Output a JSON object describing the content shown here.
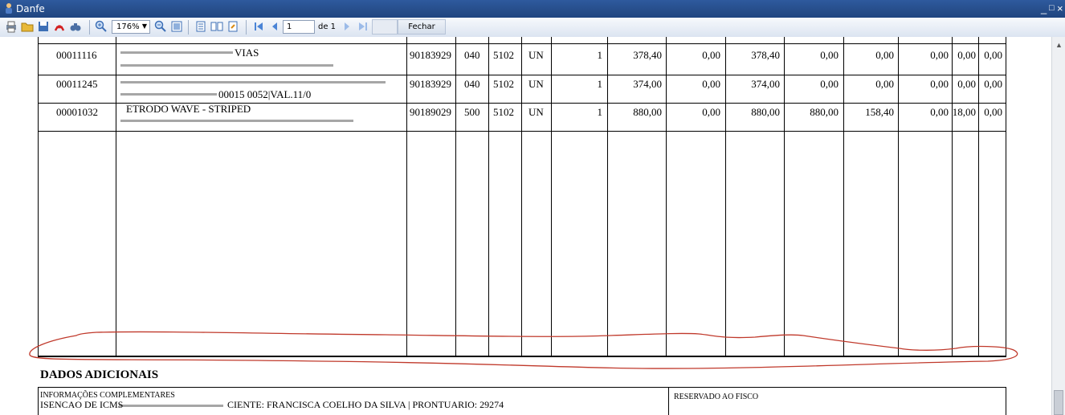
{
  "window": {
    "title": "Danfe",
    "minimize_glyph": "_",
    "restore_glyph": "□",
    "close_glyph": "×"
  },
  "toolbar": {
    "zoom_value": "176%",
    "page_current": "1",
    "page_total_label": "de 1",
    "close_label": "Fechar",
    "icons": [
      "print-icon",
      "open-icon",
      "save-icon",
      "pdf-icon",
      "find-icon",
      "zoom-in-icon",
      "zoom-out-icon",
      "fit-page-icon",
      "single-page-icon",
      "two-pages-icon",
      "page-setup-icon",
      "first-page-icon",
      "prev-page-icon",
      "next-page-icon",
      "last-page-icon"
    ]
  },
  "items": [
    {
      "code": "00011116",
      "desc_line1": "VIAS",
      "ncm": "90183929",
      "cst": "040",
      "cfop": "5102",
      "unit": "UN",
      "qty": "1",
      "unit_value": "378,40",
      "discount": "0,00",
      "total": "378,40",
      "bc_icms": "0,00",
      "icms_value": "0,00",
      "ipi_value": "0,00",
      "icms_rate": "0,00",
      "ipi_rate": "0,00"
    },
    {
      "code": "00011245",
      "desc_line1": "",
      "desc_line2": "00015 0052|VAL.11/0",
      "ncm": "90183929",
      "cst": "040",
      "cfop": "5102",
      "unit": "UN",
      "qty": "1",
      "unit_value": "374,00",
      "discount": "0,00",
      "total": "374,00",
      "bc_icms": "0,00",
      "icms_value": "0,00",
      "ipi_value": "0,00",
      "icms_rate": "0,00",
      "ipi_rate": "0,00"
    },
    {
      "code": "00001032",
      "desc_line1": "ETRODO WAVE - STRIPED",
      "ncm": "90189029",
      "cst": "500",
      "cfop": "5102",
      "unit": "UN",
      "qty": "1",
      "unit_value": "880,00",
      "discount": "0,00",
      "total": "880,00",
      "bc_icms": "880,00",
      "icms_value": "158,40",
      "ipi_value": "0,00",
      "icms_rate": "18,00",
      "ipi_rate": "0,00"
    }
  ],
  "dados_adicionais": {
    "heading": "DADOS ADICIONAIS",
    "info_label": "INFORMAÇÕES COMPLEMENTARES",
    "info_text": "ISENCAO DE ICMS",
    "info_text_rest": "CIENTE: FRANCISCA COELHO DA SILVA | PRONTUARIO: 29274",
    "reserved_label": "RESERVADO AO FISCO"
  },
  "colors": {
    "titlebar": "#264d8a",
    "toolbar": "#dbe4f1",
    "annotation": "#c0392b"
  }
}
